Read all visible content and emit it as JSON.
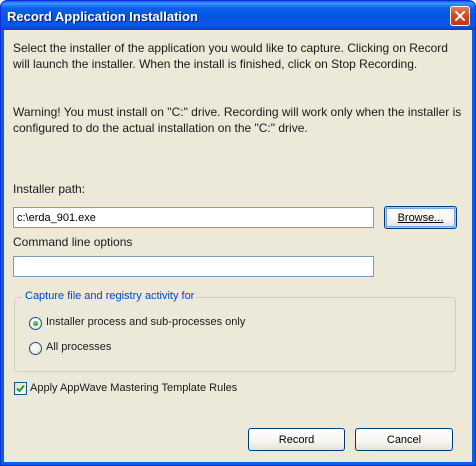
{
  "window": {
    "title": "Record Application Installation"
  },
  "description": {
    "line1": "Select the installer of the application you would like to capture.  Clicking on Record will  launch the installer.  When the install is finished, click on Stop Recording.",
    "warning": "Warning! You must install on \"C:\" drive. Recording will work only when the installer is configured to do the actual installation on the \"C:\" drive."
  },
  "installer": {
    "label": "Installer path:",
    "value": "c:\\erda_901.exe",
    "browse_label": "Browse..."
  },
  "command_line": {
    "label": "Command line options",
    "value": ""
  },
  "capture": {
    "group_title": "Capture file and registry activity for",
    "options": [
      {
        "label": "Installer process and sub-processes only",
        "selected": true
      },
      {
        "label": "All processes",
        "selected": false
      }
    ]
  },
  "mastering": {
    "label": "Apply AppWave Mastering Template Rules",
    "checked": true
  },
  "buttons": {
    "record_label": "Record",
    "cancel_label": "Cancel"
  },
  "colors": {
    "title_bar": "#0554e0",
    "client_bg": "#ece9d8",
    "group_title": "#0046d5",
    "close_button": "#d9461e"
  },
  "icons": {
    "close": "close-icon",
    "radio_selected": "radio-selected-icon",
    "checkmark": "checkmark-icon"
  }
}
